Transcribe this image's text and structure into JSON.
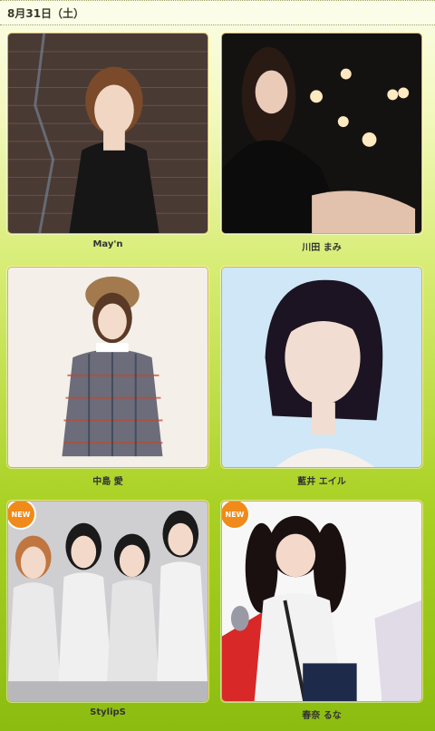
{
  "header": {
    "date": "8月31日（土）"
  },
  "artists": [
    {
      "name": "May'n",
      "new": false
    },
    {
      "name": "川田 まみ",
      "new": false
    },
    {
      "name": "中島 愛",
      "new": false
    },
    {
      "name": "藍井 エイル",
      "new": false
    },
    {
      "name": "StylipS",
      "new": true,
      "badge": "NEW"
    },
    {
      "name": "春奈 るな",
      "new": true,
      "badge": "NEW"
    }
  ]
}
